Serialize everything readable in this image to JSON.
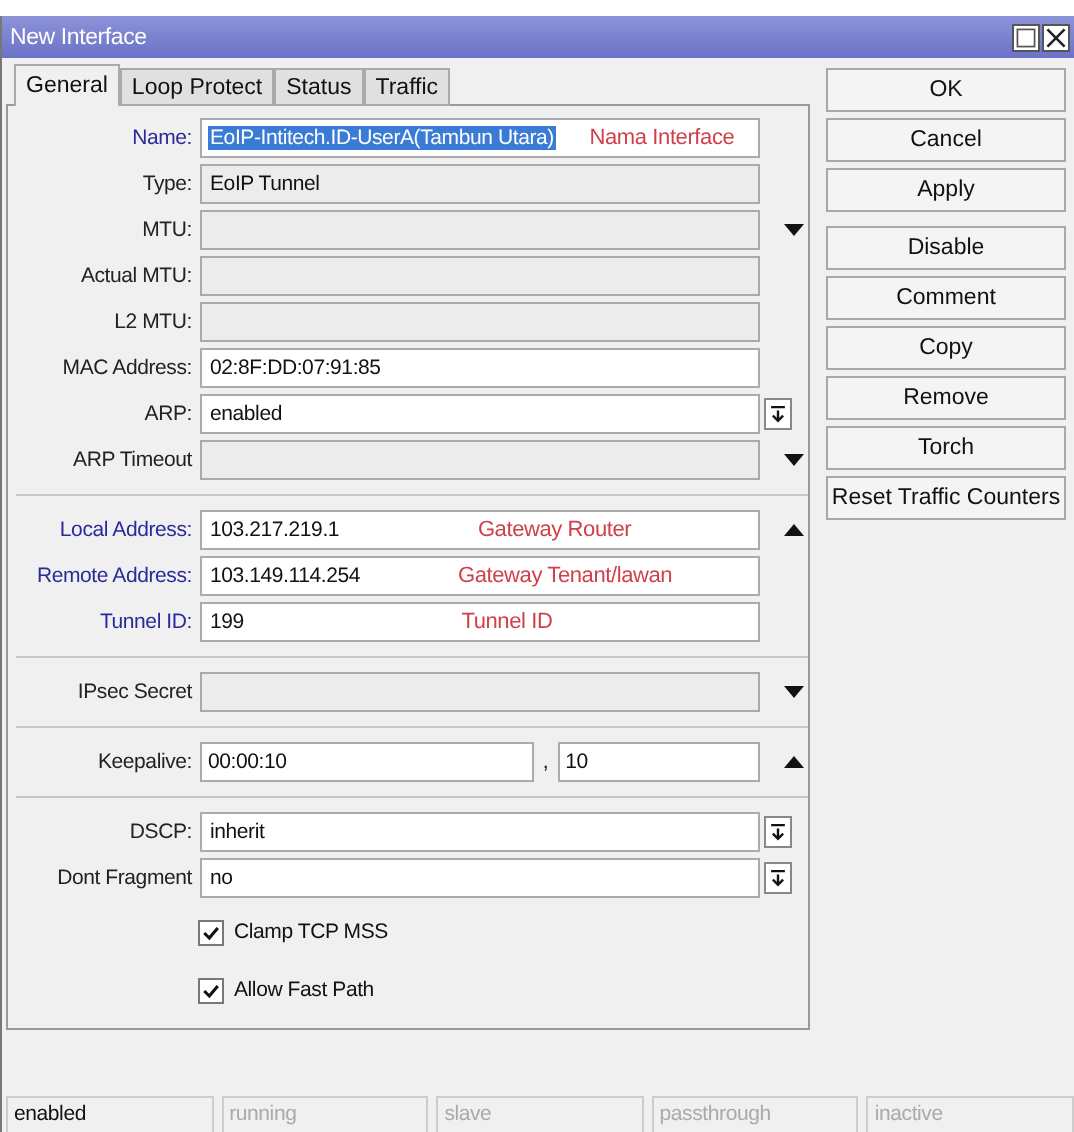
{
  "window": {
    "title": "New Interface"
  },
  "tabs": [
    {
      "label": "General",
      "selected": true
    },
    {
      "label": "Loop Protect",
      "selected": false
    },
    {
      "label": "Status",
      "selected": false
    },
    {
      "label": "Traffic",
      "selected": false
    }
  ],
  "fields": [
    {
      "kind": "field",
      "label": "Name:",
      "value": "EoIP-Intitech.ID-UserA(Tambun Utara)",
      "editable": true,
      "highlighted": true,
      "value_selected": true,
      "note": "Nama Interface"
    },
    {
      "kind": "field",
      "label": "Type:",
      "value": "EoIP Tunnel",
      "editable": false,
      "highlighted": false
    },
    {
      "kind": "field",
      "label": "MTU:",
      "editable": false,
      "highlighted": false,
      "suffix": {
        "kind": "dropdown"
      }
    },
    {
      "kind": "field",
      "label": "Actual MTU:",
      "editable": false,
      "highlighted": false
    },
    {
      "kind": "field",
      "label": "L2 MTU:",
      "editable": false,
      "highlighted": false
    },
    {
      "kind": "field",
      "label": "MAC Address:",
      "value": "02:8F:DD:07:91:85",
      "editable": true,
      "highlighted": false
    },
    {
      "kind": "field",
      "label": "ARP:",
      "value": "enabled",
      "editable": true,
      "highlighted": false,
      "suffix": {
        "kind": "select"
      }
    },
    {
      "kind": "field",
      "label": "ARP Timeout",
      "editable": false,
      "highlighted": false,
      "suffix": {
        "kind": "dropdown"
      }
    },
    {
      "kind": "separator"
    },
    {
      "kind": "field",
      "label": "Local Address:",
      "value": "103.217.219.1",
      "editable": true,
      "highlighted": true,
      "suffix": {
        "kind": "up"
      },
      "note": "Gateway Router"
    },
    {
      "kind": "field",
      "label": "Remote Address:",
      "value": "103.149.114.254",
      "editable": true,
      "highlighted": true,
      "note": "Gateway Tenant/lawan"
    },
    {
      "kind": "field",
      "label": "Tunnel ID:",
      "value": "199",
      "editable": true,
      "highlighted": true,
      "note": "Tunnel ID"
    },
    {
      "kind": "separator"
    },
    {
      "kind": "field",
      "label": "IPsec Secret",
      "editable": false,
      "highlighted": false,
      "suffix": {
        "kind": "dropdown"
      }
    },
    {
      "kind": "separator"
    },
    {
      "kind": "pair",
      "label": "Keepalive:",
      "value": "00:00:10",
      "joiner": ",",
      "value2": "10",
      "suffix": {
        "kind": "up"
      }
    },
    {
      "kind": "separator"
    },
    {
      "kind": "field",
      "label": "DSCP:",
      "value": "inherit",
      "editable": true,
      "highlighted": false,
      "suffix": {
        "kind": "select"
      }
    },
    {
      "kind": "field",
      "label": "Dont Fragment",
      "value": "no",
      "editable": true,
      "highlighted": false,
      "suffix": {
        "kind": "select"
      }
    },
    {
      "kind": "checkbox",
      "label": "Clamp TCP MSS",
      "checked": true
    },
    {
      "kind": "checkbox",
      "label": "Allow Fast Path",
      "checked": true
    }
  ],
  "buttons": [
    "OK",
    "Cancel",
    "Apply",
    "Disable",
    "Comment",
    "Copy",
    "Remove",
    "Torch",
    "Reset Traffic Counters"
  ],
  "status_bar": [
    {
      "label": "enabled",
      "active": true
    },
    {
      "label": "running",
      "active": false
    },
    {
      "label": "slave",
      "active": false
    },
    {
      "label": "passthrough",
      "active": false
    },
    {
      "label": "inactive",
      "active": false
    }
  ]
}
